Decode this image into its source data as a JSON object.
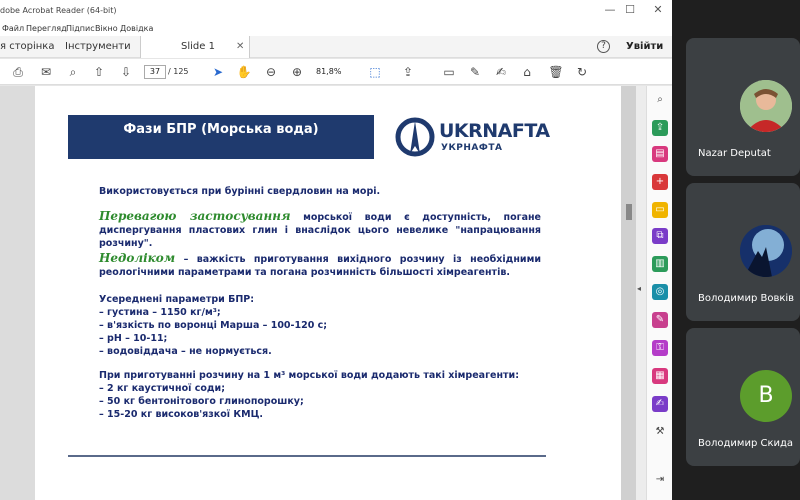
{
  "window": {
    "title": "dobe Acrobat Reader (64-bit)",
    "controls": [
      "—",
      "☐",
      "✕"
    ]
  },
  "menu": [
    "Файл",
    "Перегляд",
    "Підпис",
    "Вікно",
    "Довідка"
  ],
  "tabs": {
    "home": "я сторінка",
    "tools": "Інструменти",
    "document": "Slide 1",
    "close": "✕"
  },
  "header": {
    "help": "?",
    "signin": "Увійти"
  },
  "toolbar": {
    "current_page": "37",
    "total_pages": "/ 125",
    "zoom": "81,8%"
  },
  "slide": {
    "title": "Фази БПР (Морська вода)",
    "logo_name": "UKRNAFTA",
    "logo_sub": "УКРНАФТА",
    "intro": "Використовується при бурінні свердловин на морі.",
    "advantage_label": "Перевагою застосування",
    "advantage_text": " морської води є доступність, погане диспергування пластових глин і внаслідок цього невелике \"напрацювання розчину\".",
    "drawback_label": "Недоліком",
    "drawback_text": " – важкість приготування вихідного розчину із необхідними реологічними параметрами та погана розчинність більшості хімреагентів.",
    "params_title": "Усереднені параметри БПР:",
    "params": [
      "– густина – 1150 кг/м³;",
      "– в'язкість по воронці Марша – 100-120 с;",
      "– рН – 10-11;",
      "– водовіддача – не нормується."
    ],
    "prep_title": "При приготуванні розчину на 1 м³ морської води додають такі хімреагенти:",
    "prep": [
      "– 2 кг каустичної соди;",
      "– 50 кг бентонітового глинопорошку;",
      "– 15-20 кг високов'язкої КМЦ."
    ]
  },
  "participants": [
    {
      "name": "Nazar Deputat"
    },
    {
      "name": "Володимир Вовків"
    },
    {
      "name": "Володимир Скида",
      "initial": "В"
    }
  ],
  "colors": {
    "title_box": "#1f3a6e",
    "body_text": "#1a2a6e",
    "italic_green": "#2e8b2e",
    "initial_avatar": "#5c9d2c",
    "meet_background": "#1f1f1f",
    "tile_background": "#3c4043"
  }
}
